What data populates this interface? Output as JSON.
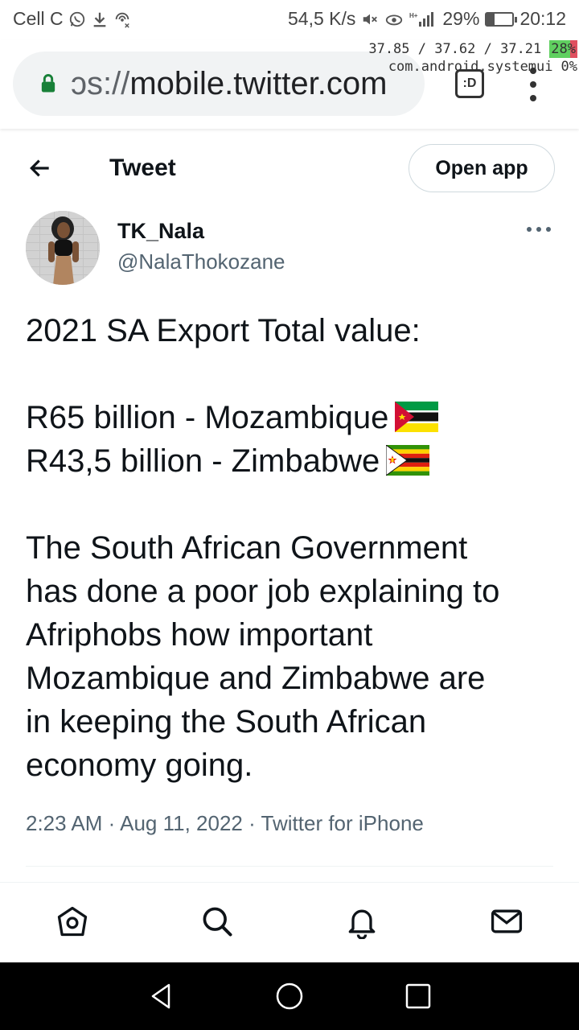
{
  "status_bar": {
    "carrier": "Cell C",
    "net_speed": "54,5 K/s",
    "network_badge": "H+",
    "battery_percent": "29%",
    "battery_level": 0.29,
    "time": "20:12"
  },
  "overlay": {
    "load": "37.85 / 37.62 / 37.21",
    "cpu": "28%",
    "process": "com.android.systemui",
    "process_cpu": "0%"
  },
  "browser": {
    "url_scheme": "ɔs://",
    "url_host": "mobile.twitter.com",
    "tabs_label": ":D"
  },
  "header": {
    "title": "Tweet",
    "open_app": "Open app"
  },
  "tweet": {
    "name": "TK_Nala",
    "handle": "@NalaThokozane",
    "line1": "2021 SA Export Total value:",
    "line2": "R65 billion - Mozambique",
    "line3": "R43,5 billion - Zimbabwe",
    "para": [
      "The South African Government",
      "has done a poor job explaining to",
      "Afriphobs how important",
      "Mozambique and Zimbabwe are",
      "in keeping the South African",
      "economy going."
    ],
    "time": "2:23 AM",
    "date": "Aug 11, 2022",
    "source": "Twitter for iPhone",
    "separator": "·"
  },
  "icons": {
    "flag1": "mozambique-flag",
    "flag2": "zimbabwe-flag"
  }
}
